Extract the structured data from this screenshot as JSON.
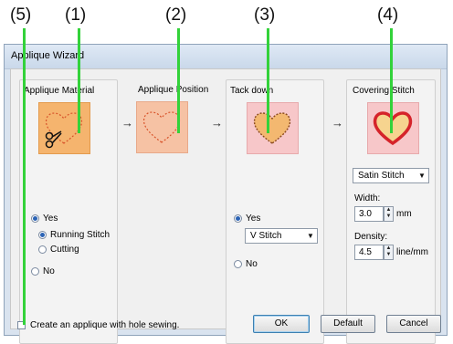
{
  "callouts": [
    "(5)",
    "(1)",
    "(2)",
    "(3)",
    "(4)"
  ],
  "window": {
    "title": "Applique Wizard"
  },
  "panels": {
    "material": {
      "title": "Applique Material",
      "yes_label": "Yes",
      "running_stitch_label": "Running Stitch",
      "cutting_label": "Cutting",
      "no_label": "No"
    },
    "position": {
      "title": "Applique Position"
    },
    "tackdown": {
      "title": "Tack down",
      "yes_label": "Yes",
      "stitch_value": "V Stitch",
      "no_label": "No"
    },
    "covering": {
      "title": "Covering Stitch",
      "stitch_value": "Satin Stitch",
      "width_label": "Width:",
      "width_value": "3.0",
      "width_unit": "mm",
      "density_label": "Density:",
      "density_value": "4.5",
      "density_unit": "line/mm"
    }
  },
  "hole_sewing_label": "Create an applique with hole sewing.",
  "buttons": {
    "ok": "OK",
    "default": "Default",
    "cancel": "Cancel"
  },
  "colors": {
    "callout_line": "#33d23a",
    "material_fill": "#f5b46e",
    "position_fill": "#f6c2a4",
    "tack_fill": "#f7c7c9",
    "cover_fill": "#f7c7c9"
  }
}
